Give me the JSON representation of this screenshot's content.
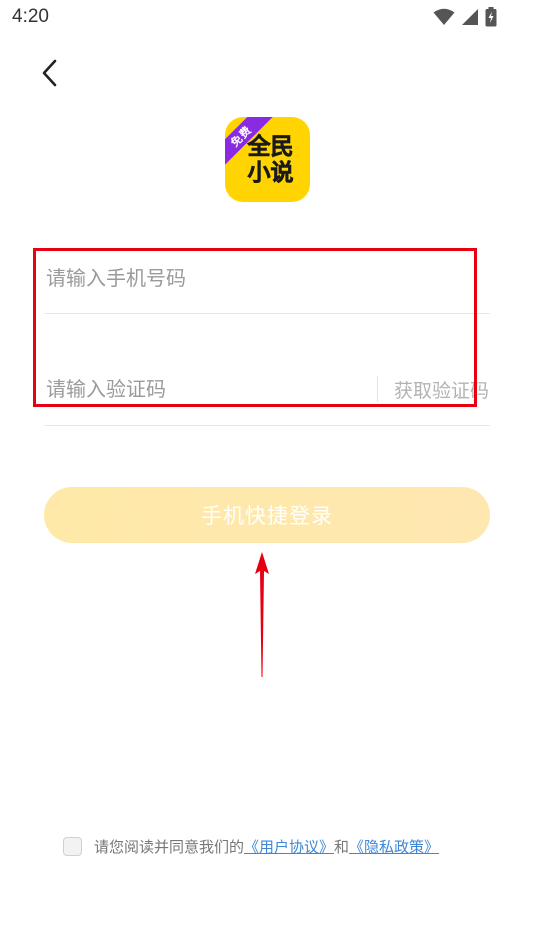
{
  "status_bar": {
    "time": "4:20",
    "icons": [
      "wifi-icon",
      "signal-icon",
      "battery-charging-icon"
    ]
  },
  "header": {
    "back_icon": "chevron-left-icon"
  },
  "logo": {
    "ribbon": "免费",
    "line1": "全民",
    "line2": "小说",
    "colors": {
      "background": "#ffd400",
      "ribbon": "#8a2be2"
    }
  },
  "form": {
    "phone_placeholder": "请输入手机号码",
    "phone_value": "",
    "code_placeholder": "请输入验证码",
    "code_value": "",
    "get_code_label": "获取验证码",
    "login_label": "手机快捷登录"
  },
  "agreement": {
    "checked": false,
    "prefix": "请您阅读并同意我们的",
    "user_agreement": "《用户协议》",
    "connector": "和",
    "privacy_policy": "《隐私政策》"
  },
  "colors": {
    "login_button": "#ffe9a8",
    "link": "#3e86d6",
    "annotation": "#e60012"
  }
}
